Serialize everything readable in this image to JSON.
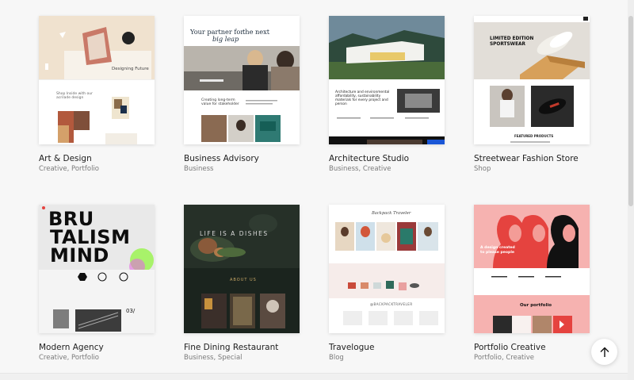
{
  "templates": [
    {
      "name": "Art & Design",
      "category": "Creative, Portfolio"
    },
    {
      "name": "Business Advisory",
      "category": "Business"
    },
    {
      "name": "Architecture Studio",
      "category": "Business, Creative"
    },
    {
      "name": "Streetwear Fashion Store",
      "category": "Shop"
    },
    {
      "name": "Modern Agency",
      "category": "Creative, Portfolio"
    },
    {
      "name": "Fine Dining Restaurant",
      "category": "Business, Special"
    },
    {
      "name": "Travelogue",
      "category": "Blog"
    },
    {
      "name": "Portfolio Creative",
      "category": "Portfolio, Creative"
    }
  ],
  "previews": {
    "art_caption": "Designing Future",
    "art_text": "Shop Inside with our acrilade design",
    "business_headline_1": "Your partner for",
    "business_headline_2": "the next",
    "business_headline_3": "big leap",
    "business_text": "Creating long-term value for stakeholder",
    "arch_text": "Architecture and environmental affordability, sustainability materials for every project and person",
    "street_headline_1": "LIMITED EDITION",
    "street_headline_2": "SPORTSWEAR",
    "street_featured": "FEATURED PRODUCTS",
    "agency_word_1": "BRU",
    "agency_word_2": "TALISM",
    "agency_word_3": "MIND",
    "agency_counter": "03/",
    "dining_title": "LIFE IS A DISHES",
    "dining_about": "ABOUT US",
    "travel_logo": "Backpack Traveler",
    "travel_insta": "@BACKPACKTRAVELER",
    "portfolio_text": "A design created to please people",
    "portfolio_section": "Our portfolio"
  },
  "colors": {
    "portfolio_pink": "#f6b2b0",
    "portfolio_red": "#e5433f",
    "dining_dark": "#1d2620",
    "arch_night": "#111111"
  }
}
